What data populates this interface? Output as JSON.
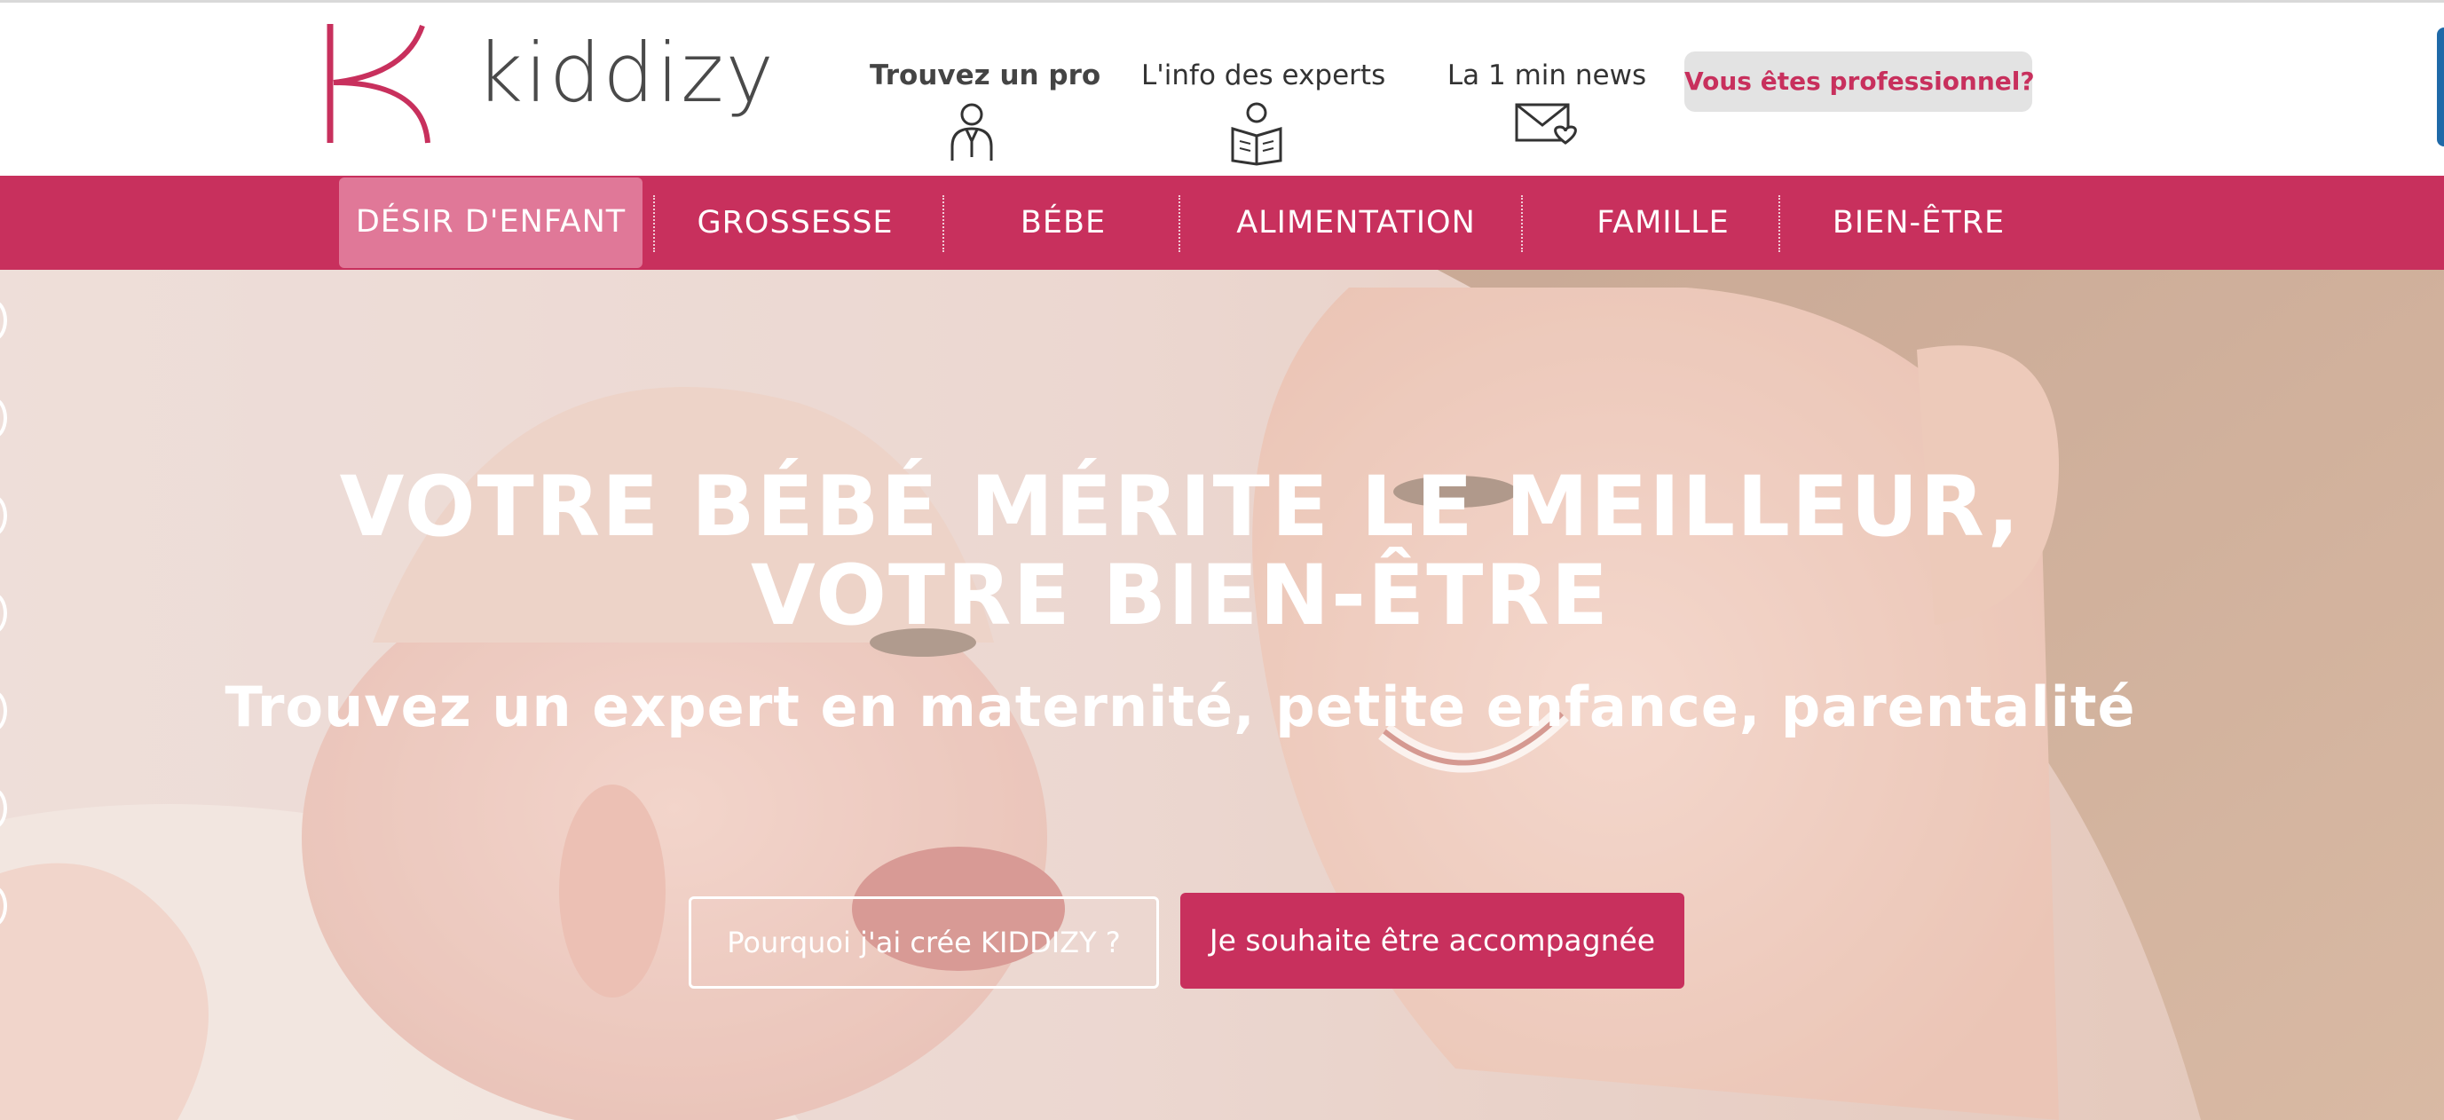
{
  "header": {
    "logo_text": "kiddizy",
    "top_links": [
      {
        "label": "Trouvez un pro",
        "icon": "professional-person-icon"
      },
      {
        "label": "L'info des experts",
        "icon": "reading-person-icon"
      },
      {
        "label": "La 1 min news",
        "icon": "envelope-heart-icon"
      }
    ],
    "pro_button": "Vous êtes professionnel?"
  },
  "nav": {
    "items": [
      "DÉSIR D'ENFANT",
      "GROSSESSE",
      "BÉBE",
      "ALIMENTATION",
      "FAMILLE",
      "BIEN-ÊTRE"
    ],
    "active_index": 0
  },
  "hero": {
    "title_line1": "VOTRE BÉBÉ MÉRITE LE MEILLEUR,",
    "title_line2": "VOTRE BIEN-ÊTRE",
    "subtitle": "Trouvez un expert en maternité, petite enfance, parentalité",
    "button_secondary": "Pourquoi j'ai crée KIDDIZY ?",
    "button_primary": "Je souhaite être accompagnée"
  },
  "colors": {
    "brand": "#c8305d",
    "nav_active": "#e07898",
    "pro_button_bg": "#e3e3e3",
    "text_dark": "#333333"
  }
}
